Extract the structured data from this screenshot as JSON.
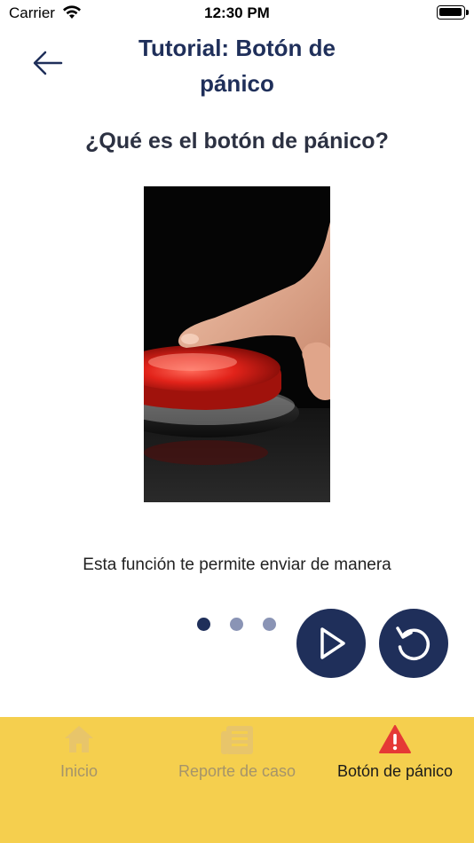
{
  "status_bar": {
    "carrier": "Carrier",
    "time": "12:30 PM"
  },
  "header": {
    "title_line1": "Tutorial: Botón de",
    "title_line2": "pánico",
    "back_icon": "arrow-left-icon"
  },
  "content": {
    "heading": "¿Qué es el botón de pánico?",
    "image": "panic-button-photo",
    "description": "Esta función te permite enviar de manera"
  },
  "pagination": {
    "count": 3,
    "active_index": 0
  },
  "controls": {
    "play_icon": "play-icon",
    "replay_icon": "replay-icon"
  },
  "tab_bar": {
    "tabs": [
      {
        "label": "Inicio",
        "icon": "home-icon",
        "active": false
      },
      {
        "label": "Reporte de caso",
        "icon": "document-icon",
        "active": false
      },
      {
        "label": "Botón de pánico",
        "icon": "warning-icon",
        "active": true
      }
    ]
  },
  "colors": {
    "primary": "#1f2f5a",
    "tab_bar_bg": "#f5cf4e",
    "dot_inactive": "#8a94b5",
    "tab_inactive": "#a5946a",
    "warning_red": "#e53935"
  }
}
